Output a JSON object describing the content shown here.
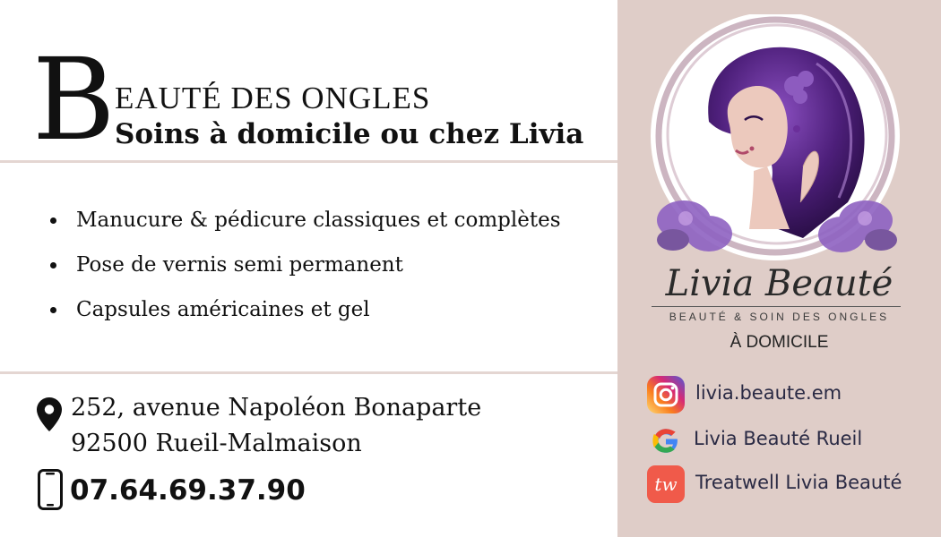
{
  "header": {
    "dropcap": "B",
    "title_rest": "EAUTÉ DES ONGLES",
    "subtitle": "Soins à domicile ou chez Livia"
  },
  "services": [
    "Manucure & pédicure classiques et complètes",
    "Pose de vernis semi permanent",
    "Capsules américaines et gel"
  ],
  "contact": {
    "address_line1": "252, avenue Napoléon Bonaparte",
    "address_line2": "92500 Rueil-Malmaison",
    "phone": "07.64.69.37.90",
    "pin_icon": "location-pin-icon",
    "phone_icon": "mobile-phone-icon"
  },
  "brand": {
    "name": "Livia Beauté",
    "tagline": "BEAUTÉ & SOIN DES ONGLES",
    "service_mode": "À DOMICILE"
  },
  "social": [
    {
      "icon": "instagram-icon",
      "label": "livia.beaute.em"
    },
    {
      "icon": "google-icon",
      "label": "Livia Beauté Rueil"
    },
    {
      "icon": "treatwell-icon",
      "icon_text": "tw",
      "label": "Treatwell Livia Beauté"
    }
  ],
  "colors": {
    "right_panel": "#dfcdc8",
    "divider": "#e4d6d2",
    "accent_purple": "#5b2a86",
    "treatwell": "#f05a4a"
  }
}
